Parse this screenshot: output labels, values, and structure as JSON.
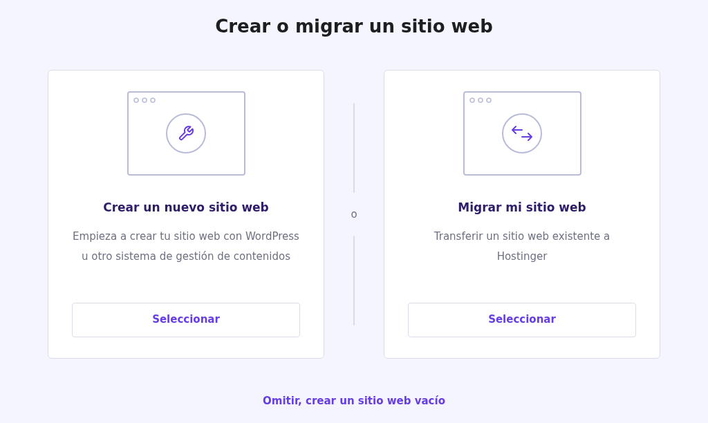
{
  "title": "Crear o migrar un sitio web",
  "options": [
    {
      "kind": "create",
      "title": "Crear un nuevo sitio web",
      "description": "Empieza a crear tu sitio web con WordPress u otro sistema de gestión de contenidos",
      "button": "Seleccionar"
    },
    {
      "kind": "migrate",
      "title": "Migrar mi sitio web",
      "description": "Transferir un sitio web existente a Hostinger",
      "button": "Seleccionar"
    }
  ],
  "separator": "o",
  "skip_link": "Omitir, crear un sitio web vacío"
}
